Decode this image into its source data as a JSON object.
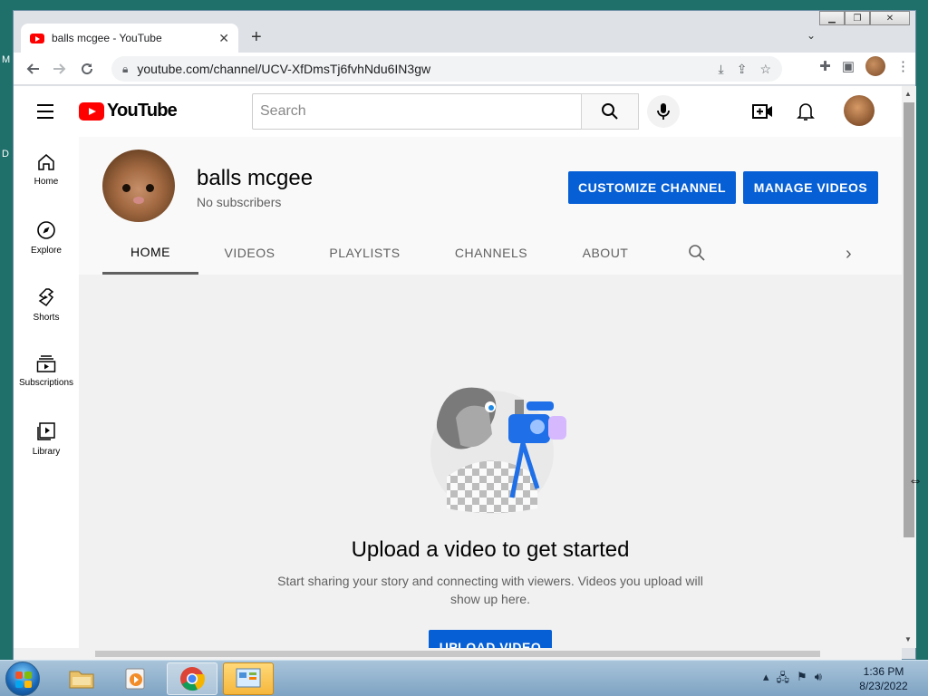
{
  "desktop": {
    "edge_letters": [
      "M",
      "D"
    ]
  },
  "browser": {
    "tab_title": "balls mcgee - YouTube",
    "url": "youtube.com/channel/UCV-XfDmsTj6fvhNdu6IN3gw",
    "window_controls": [
      "minimize",
      "restore",
      "close"
    ]
  },
  "youtube": {
    "logo_text": "YouTube",
    "search_placeholder": "Search",
    "sidebar": [
      {
        "label": "Home",
        "icon": "home-icon"
      },
      {
        "label": "Explore",
        "icon": "compass-icon"
      },
      {
        "label": "Shorts",
        "icon": "shorts-icon"
      },
      {
        "label": "Subscriptions",
        "icon": "subscriptions-icon"
      },
      {
        "label": "Library",
        "icon": "library-icon"
      }
    ],
    "channel": {
      "name": "balls mcgee",
      "subscribers": "No subscribers",
      "customize_label": "CUSTOMIZE CHANNEL",
      "manage_label": "MANAGE VIDEOS",
      "tabs": [
        "HOME",
        "VIDEOS",
        "PLAYLISTS",
        "CHANNELS",
        "ABOUT"
      ],
      "active_tab": "HOME"
    },
    "empty_state": {
      "title": "Upload a video to get started",
      "description": "Start sharing your story and connecting with viewers. Videos you upload will show up here.",
      "button_label": "UPLOAD VIDEO"
    }
  },
  "taskbar": {
    "time": "1:36 PM",
    "date": "8/23/2022"
  },
  "colors": {
    "accent_blue": "#065fd4",
    "youtube_red": "#ff0000",
    "desktop_teal": "#1f6f6b"
  }
}
